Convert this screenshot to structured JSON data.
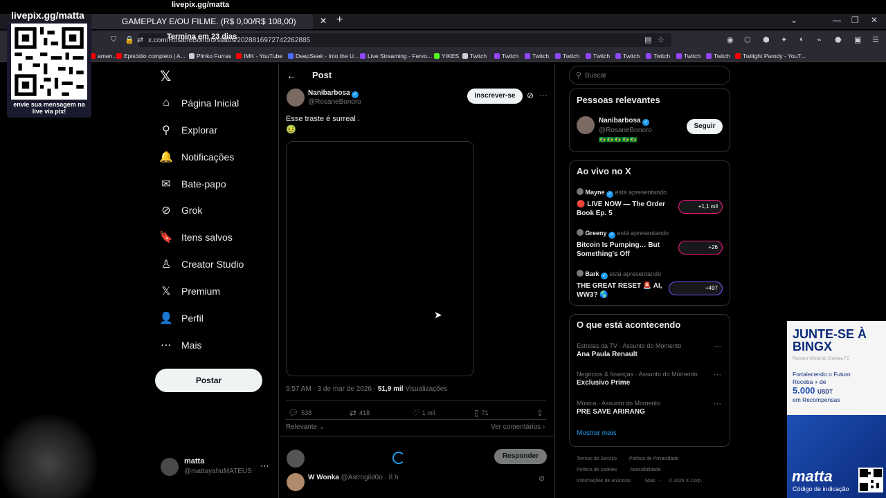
{
  "overlay": {
    "top_title": "livepix.gg/matta",
    "livepix_title": "livepix.gg/matta",
    "qr_caption": "envie sua mensagem na live via pix!",
    "countdown": "Termina em 23 dias"
  },
  "browser": {
    "active_tab": "GAMEPLAY E/OU FILME. (R$ 0,00/R$ 108,00)",
    "url": "x.com/RosaneBonoro/status/2028816972742262885",
    "bookmarks": [
      {
        "label": "amen...",
        "color": "#ff0000"
      },
      {
        "label": "Episódio completo | A...",
        "color": "#ff0000"
      },
      {
        "label": "Plinko Furras",
        "color": "#cfcfd8"
      },
      {
        "label": "IMK - YouTube",
        "color": "#ff0000"
      },
      {
        "label": "DeepSeek - Into the U...",
        "color": "#4d6bfe"
      },
      {
        "label": "Live Streaming - Fervo...",
        "color": "#9146ff"
      },
      {
        "label": "YIKES",
        "color": "#53fc18"
      },
      {
        "label": "Twitch",
        "color": "#cfcfd8"
      },
      {
        "label": "Twitch",
        "color": "#9146ff"
      },
      {
        "label": "Twitch",
        "color": "#9146ff"
      },
      {
        "label": "Twitch",
        "color": "#9146ff"
      },
      {
        "label": "Twitch",
        "color": "#9146ff"
      },
      {
        "label": "Twitch",
        "color": "#9146ff"
      },
      {
        "label": "Twitch",
        "color": "#9146ff"
      },
      {
        "label": "Twitch",
        "color": "#9146ff"
      },
      {
        "label": "Twitch",
        "color": "#9146ff"
      },
      {
        "label": "Twilight Parody - YouT...",
        "color": "#ff0000"
      }
    ]
  },
  "nav": {
    "items": [
      {
        "label": "Página Inicial",
        "icon": "home-icon",
        "glyph": "⌂"
      },
      {
        "label": "Explorar",
        "icon": "search-icon",
        "glyph": "⚲"
      },
      {
        "label": "Notificações",
        "icon": "bell-icon",
        "glyph": "🔔"
      },
      {
        "label": "Bate-papo",
        "icon": "mail-icon",
        "glyph": "✉"
      },
      {
        "label": "Grok",
        "icon": "grok-icon",
        "glyph": "⊘"
      },
      {
        "label": "Itens salvos",
        "icon": "bookmark-icon",
        "glyph": "🔖"
      },
      {
        "label": "Creator Studio",
        "icon": "creator-icon",
        "glyph": "♙"
      },
      {
        "label": "Premium",
        "icon": "x-icon",
        "glyph": "𝕏"
      },
      {
        "label": "Perfil",
        "icon": "person-icon",
        "glyph": "👤"
      },
      {
        "label": "Mais",
        "icon": "more-icon",
        "glyph": "⋯"
      }
    ],
    "post_button": "Postar",
    "account_name": "matta",
    "account_handle": "@mattayahuMATEUS"
  },
  "post": {
    "header": "Post",
    "author_name": "Nanibarbosa",
    "author_handle": "@RosaneBonoro",
    "subscribe": "Inscrever-se",
    "text": "Esse traste é surreal .",
    "emoji": "🤢",
    "time": "9:57 AM · 3 de mar de 2026 · ",
    "views_count": "51,9 mil",
    "views_label": " Visualizações",
    "replies": "538",
    "reposts": "418",
    "likes": "1 mil",
    "bookmarks": "71",
    "sort_label": "Relevante",
    "view_comments": "Ver comentários",
    "reply_button": "Responder",
    "reply_author": "W Wonka",
    "reply_handle": "@Astrogild0o · 8 h"
  },
  "sidebar": {
    "search_placeholder": "Buscar",
    "relevant_title": "Pessoas relevantes",
    "relevant_name": "Nanibarbosa",
    "relevant_handle": "@RosaneBonoro",
    "relevant_flags": "🇧🇷🇧🇷🇧🇷🇧🇷🇧🇷",
    "follow_button": "Seguir",
    "live_title": "Ao vivo no X",
    "presenting": "está apresentando",
    "live": [
      {
        "host": "Mayne",
        "title": "🔴 LIVE NOW — The Order Book Ep. 5",
        "count": "+1,1 mil"
      },
      {
        "host": "Greeny",
        "title": "Bitcoin Is Pumping… But Something's Off",
        "count": "+26"
      },
      {
        "host": "Bark",
        "title": "THE GREAT RESET 🚨 AI, WW3? 🌎",
        "count": "+497"
      }
    ],
    "trends_title": "O que está acontecendo",
    "trends": [
      {
        "category": "Estrelas da TV · Assunto do Momento",
        "name": "Ana Paula Renault"
      },
      {
        "category": "Negócios & finanças · Assunto do Momento",
        "name": "Exclusivo Prime"
      },
      {
        "category": "Música · Assunto do Momento",
        "name": "PRE SAVE ARIRANG"
      }
    ],
    "show_more": "Mostrar mais",
    "footer": [
      "Termos de Serviço",
      "Política de Privacidade",
      "Política de cookies",
      "Acessibilidade",
      "Informações de anúncios",
      "Mais ···",
      "© 2026 X Corp."
    ]
  },
  "ad": {
    "headline": "JUNTE-SE À BINGX",
    "sub": "Parceiro Oficial do Chelsea FC",
    "line1": "Fortalecendo o Futuro",
    "line2": "Receba + de",
    "amount": "5.000",
    "unit": "USDT",
    "line3": "em Recompensas",
    "logo": "matta",
    "logo_sub": "Código de indicação"
  }
}
